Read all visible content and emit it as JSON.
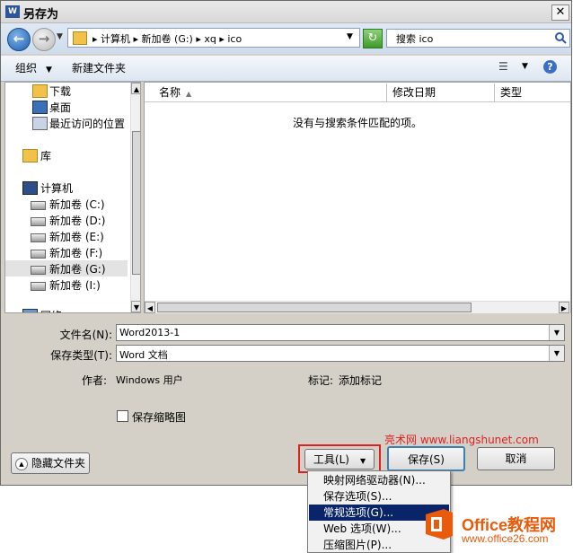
{
  "window": {
    "title": "另存为",
    "app_badge": "W",
    "close_glyph": "✕"
  },
  "address": {
    "breadcrumbs": [
      "计算机",
      "新加卷 (G:)",
      "xq",
      "ico"
    ],
    "breadcrumb_text": "▸ 计算机 ▸ 新加卷 (G:) ▸ xq ▸ ico"
  },
  "search": {
    "placeholder": "搜索 ico"
  },
  "toolbar": {
    "organize": "组织",
    "new_folder": "新建文件夹"
  },
  "nav": {
    "items": [
      {
        "label": "下载",
        "icon": "download-folder-icon"
      },
      {
        "label": "桌面",
        "icon": "desktop-icon"
      },
      {
        "label": "最近访问的位置",
        "icon": "recent-places-icon"
      },
      {
        "label": "库",
        "icon": "library-icon"
      },
      {
        "label": "计算机",
        "icon": "computer-icon"
      },
      {
        "label": "新加卷 (C:)",
        "icon": "drive-icon"
      },
      {
        "label": "新加卷 (D:)",
        "icon": "drive-icon"
      },
      {
        "label": "新加卷 (E:)",
        "icon": "drive-icon"
      },
      {
        "label": "新加卷 (F:)",
        "icon": "drive-icon"
      },
      {
        "label": "新加卷 (G:)",
        "icon": "drive-icon",
        "selected": true
      },
      {
        "label": "新加卷 (I:)",
        "icon": "drive-icon"
      },
      {
        "label": "网络",
        "icon": "network-icon"
      }
    ]
  },
  "filelist": {
    "columns": [
      "名称",
      "修改日期",
      "类型"
    ],
    "empty_message": "没有与搜索条件匹配的项。"
  },
  "form": {
    "filename_label": "文件名(N):",
    "filename_value": "Word2013-1",
    "filetype_label": "保存类型(T):",
    "filetype_value": "Word 文档",
    "author_label": "作者:",
    "author_value": "Windows 用户",
    "tags_label": "标记:",
    "tags_value": "添加标记",
    "thumbnail_label": "保存缩略图"
  },
  "buttons": {
    "hide_folders": "隐藏文件夹",
    "tools": "工具(L)",
    "save": "保存(S)",
    "cancel": "取消"
  },
  "tools_menu": [
    "映射网络驱动器(N)...",
    "保存选项(S)...",
    "常规选项(G)...",
    "Web 选项(W)...",
    "压缩图片(P)..."
  ],
  "watermark": {
    "site_text": "亮术网 www.liangshunet.com",
    "brand": "Office教程网",
    "url": "www.office26.com"
  },
  "colors": {
    "selection": "#0a246a",
    "highlight_border": "#e02020",
    "brand": "#e85a0c"
  }
}
